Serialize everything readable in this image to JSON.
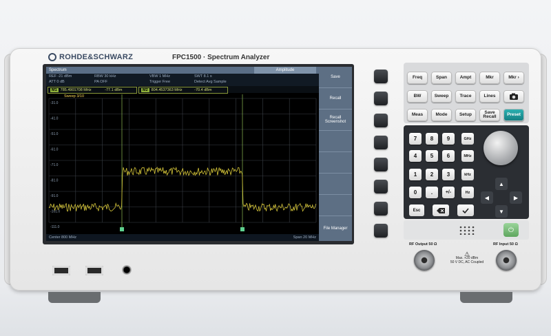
{
  "brand": {
    "name": "ROHDE&SCHWARZ",
    "model": "FPC1500 · Spectrum Analyzer"
  },
  "screen": {
    "title_left": "Spectrum",
    "title_right": "Amplitude",
    "params": [
      "REF -21 dBm",
      "RBW 30 kHz",
      "VBW 1 MHz",
      "SWT 8.1 s",
      "ATT 0 dB",
      "PA OFF",
      "Trigger Free",
      "Detect Avg Sample"
    ],
    "marker1_id": "M1",
    "marker1_freq": "785.4901708 MHz",
    "marker1_level": "-77.1 dBm",
    "marker2_id": "M2",
    "marker2_freq": "804.4537363 MHz",
    "marker2_level": "-70.4 dBm",
    "sweep": "Sweep 3/10",
    "y_ticks": [
      "-31.0",
      "-41.0",
      "-51.0",
      "-61.0",
      "-71.0",
      "-81.0",
      "-91.0",
      "-101.0",
      "-111.0"
    ],
    "center": "Center 800 MHz",
    "span": "Span 20 MHz",
    "trace_color": "#d6c63a",
    "grid_color": "#3a3f46"
  },
  "softkeys": [
    "Save",
    "Recall",
    "Recall Screenshot",
    "",
    "",
    "",
    "",
    "File Manager"
  ],
  "keys": {
    "row1": [
      "Freq",
      "Span",
      "Ampt",
      "Mkr",
      "Mkr ›"
    ],
    "row2": [
      "BW",
      "Sweep",
      "Trace",
      "Lines",
      "camera-icon"
    ],
    "row3": [
      "Meas",
      "Mode",
      "Setup",
      "Save Recall",
      "Preset"
    ]
  },
  "numpad": {
    "digits": [
      "7",
      "8",
      "9",
      "4",
      "5",
      "6",
      "1",
      "2",
      "3",
      "0",
      ".",
      "+/-"
    ],
    "units": [
      "GHz",
      "MHz",
      "kHz",
      "Hz"
    ],
    "esc": "Esc",
    "accent_color": "#137c80"
  },
  "ports": {
    "rf_output": "RF Output 50 Ω",
    "rf_input": "RF Input 50 Ω",
    "warning_line1": "Max. +20 dBm",
    "warning_line2": "50 V DC, AC Coupled"
  }
}
